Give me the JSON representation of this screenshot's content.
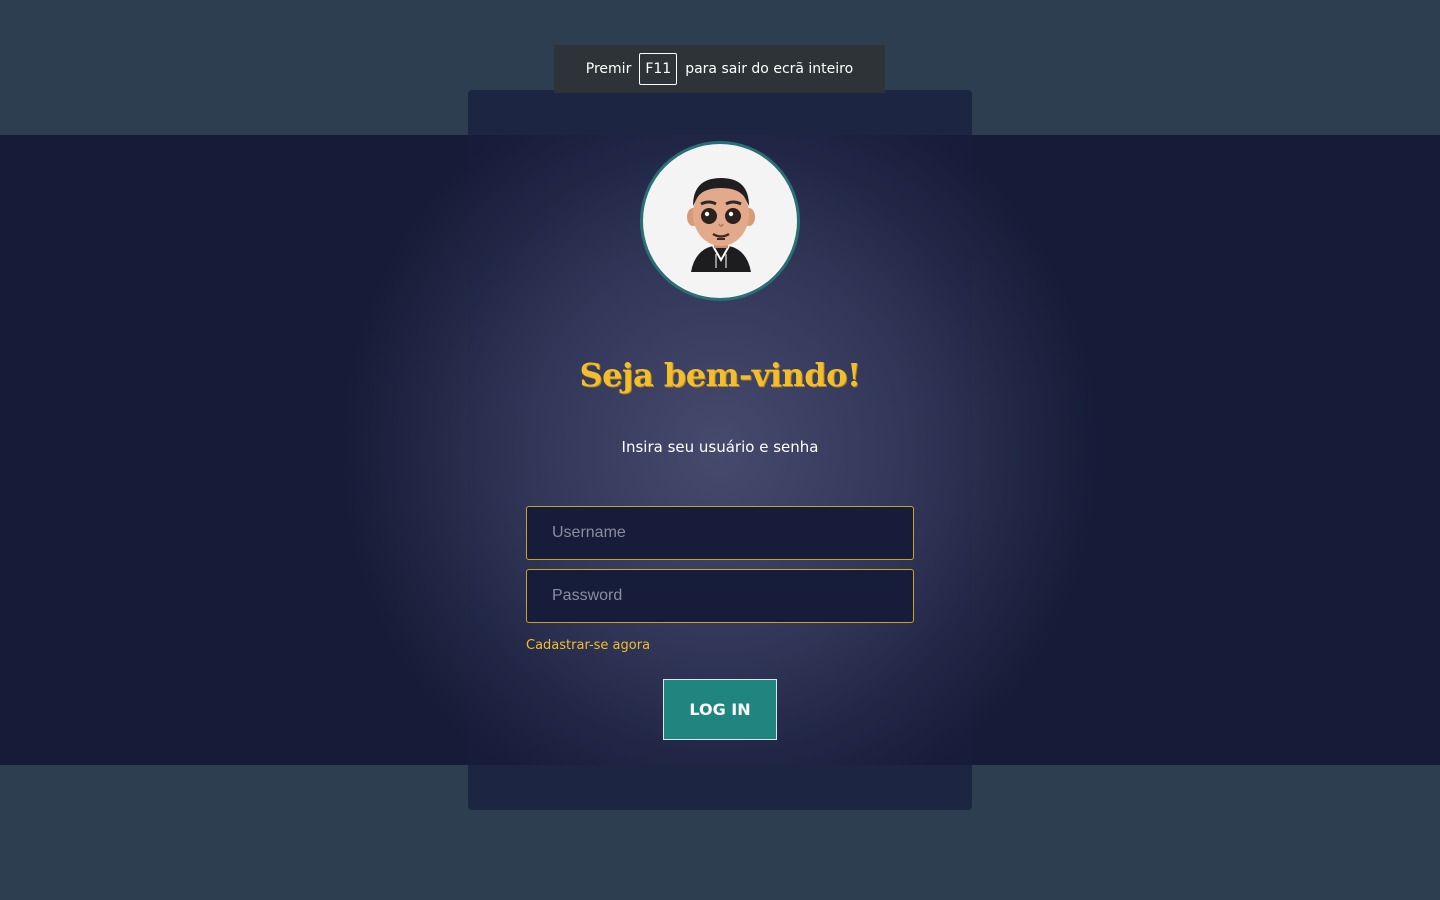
{
  "fullscreen_notice": {
    "prefix": "Premir",
    "key": "F11",
    "suffix": "para sair do ecrã inteiro"
  },
  "login": {
    "title": "Seja bem-vindo!",
    "subtitle": "Insira seu usuário e senha",
    "username_placeholder": "Username",
    "password_placeholder": "Password",
    "signup_link": "Cadastrar-se agora",
    "login_button": "LOG IN"
  },
  "colors": {
    "page_background": "#2c3e50",
    "card_background": "#1c2541",
    "accent_gold": "#f2be2e",
    "button_teal": "#21857f",
    "avatar_border": "#2a6f73"
  },
  "icons": {
    "avatar": "cartoon-avatar-icon"
  }
}
